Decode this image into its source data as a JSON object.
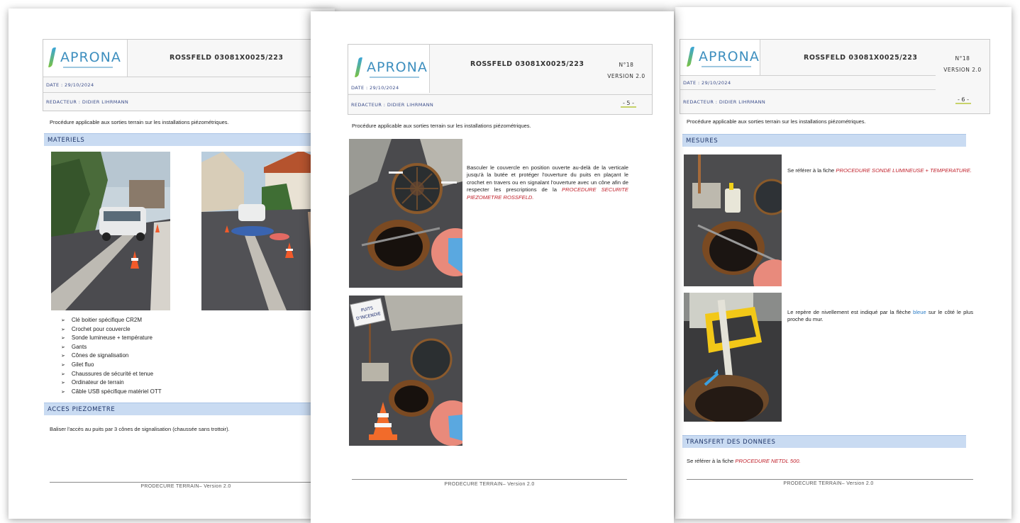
{
  "header": {
    "logo_text": "APRONA",
    "code": "ROSSFELD 03081X0025/223",
    "number": "N°18",
    "version": "VERSION 2.0",
    "date": "DATE : 29/10/2024",
    "author": "REDACTEUR : DIDIER LIHRMANN"
  },
  "intro": "Procédure applicable aux sorties terrain sur les installations piézométriques.",
  "footer": "PRODECURE TERRAIN– Version 2.0",
  "left_page": {
    "section_materials": "MATERIELS",
    "materials": [
      "Clé boitier spécifique CR2M",
      "Crochet pour couvercle",
      "Sonde lumineuse + température",
      "Gants",
      "Cônes de signalisation",
      "Gilet fluo",
      "Chaussures de sécurité et tenue",
      "Ordinateur de terrain",
      "Câble USB spécifique matériel OTT"
    ],
    "section_access": "ACCES PIEZOMETRE",
    "access_text": "Baliser l'accès au puits par 3 cônes de signalisation (chaussée sans trottoir)."
  },
  "middle_page": {
    "page_number": "- 5 -",
    "text_before": "Basculer le couvercle en position ouverte au-delà de la verticale jusqu'à la butée et protéger l'ouverture du puits en plaçant le crochet en travers ou en signalant l'ouverture avec un cône afin de respecter les prescriptions de la ",
    "text_link": "PROCEDURE SECURITE PIEZOMETRE ROSSFELD.",
    "sign_text": "PUITS D'INCENDIE"
  },
  "right_page": {
    "page_number": "- 6 -",
    "section_measures": "MESURES",
    "measure_text": "Se référer à la fiche ",
    "measure_link": "PROCEDURE SONDE LUMINEUSE + TEMPERATURE.",
    "level_text_1": "Le repère de nivellement est indiqué par la flèche ",
    "level_word_blue": "bleue",
    "level_text_2": " sur le côté le plus proche du mur.",
    "section_transfer": "TRANSFERT DES DONNEES",
    "transfer_text": "Se référer à la fiche ",
    "transfer_link": "PROCEDURE NETDL 500."
  },
  "colors": {
    "section_bg": "#c9dbf2",
    "section_text": "#1e3468",
    "link_red": "#c0212b",
    "logo_blue": "#3e8fbf"
  }
}
